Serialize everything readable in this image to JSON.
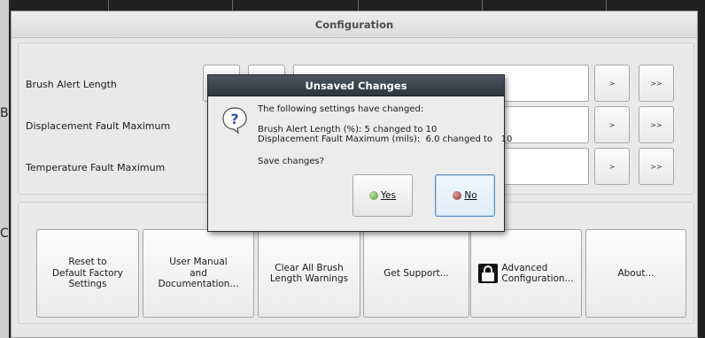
{
  "background": {
    "side_letters": [
      "B",
      "C"
    ]
  },
  "window": {
    "title": "Configuration"
  },
  "settings": {
    "rows": [
      {
        "label": "Brush Alert Length",
        "value": "",
        "next": ">",
        "last": ">>"
      },
      {
        "label": "Displacement Fault Maximum",
        "value": "",
        "next": ">",
        "last": ">>"
      },
      {
        "label": "Temperature Fault Maximum",
        "value": "",
        "next": ">",
        "last": ">>"
      }
    ]
  },
  "actions": [
    {
      "label": "Reset to\nDefault Factory\nSettings"
    },
    {
      "label": "User Manual\nand\nDocumentation..."
    },
    {
      "label": "Clear All Brush\nLength Warnings"
    },
    {
      "label": "Get Support..."
    },
    {
      "label": "Advanced\nConfiguration...",
      "icon": "lock-icon"
    },
    {
      "label": "About..."
    }
  ],
  "dialog": {
    "title": "Unsaved Changes",
    "icon": "question-icon",
    "intro": "The following settings have changed:",
    "changes": [
      "Brush Alert Length (%): 5 changed to 10",
      "Displacement Fault Maximum (mils):  6.0 changed to   10"
    ],
    "prompt": "Save changes?",
    "yes_label": "Yes",
    "no_label": "No",
    "colors": {
      "yes_dot": "#5d9a42",
      "no_dot": "#8f3434",
      "default_border": "#5c8fc1"
    }
  }
}
